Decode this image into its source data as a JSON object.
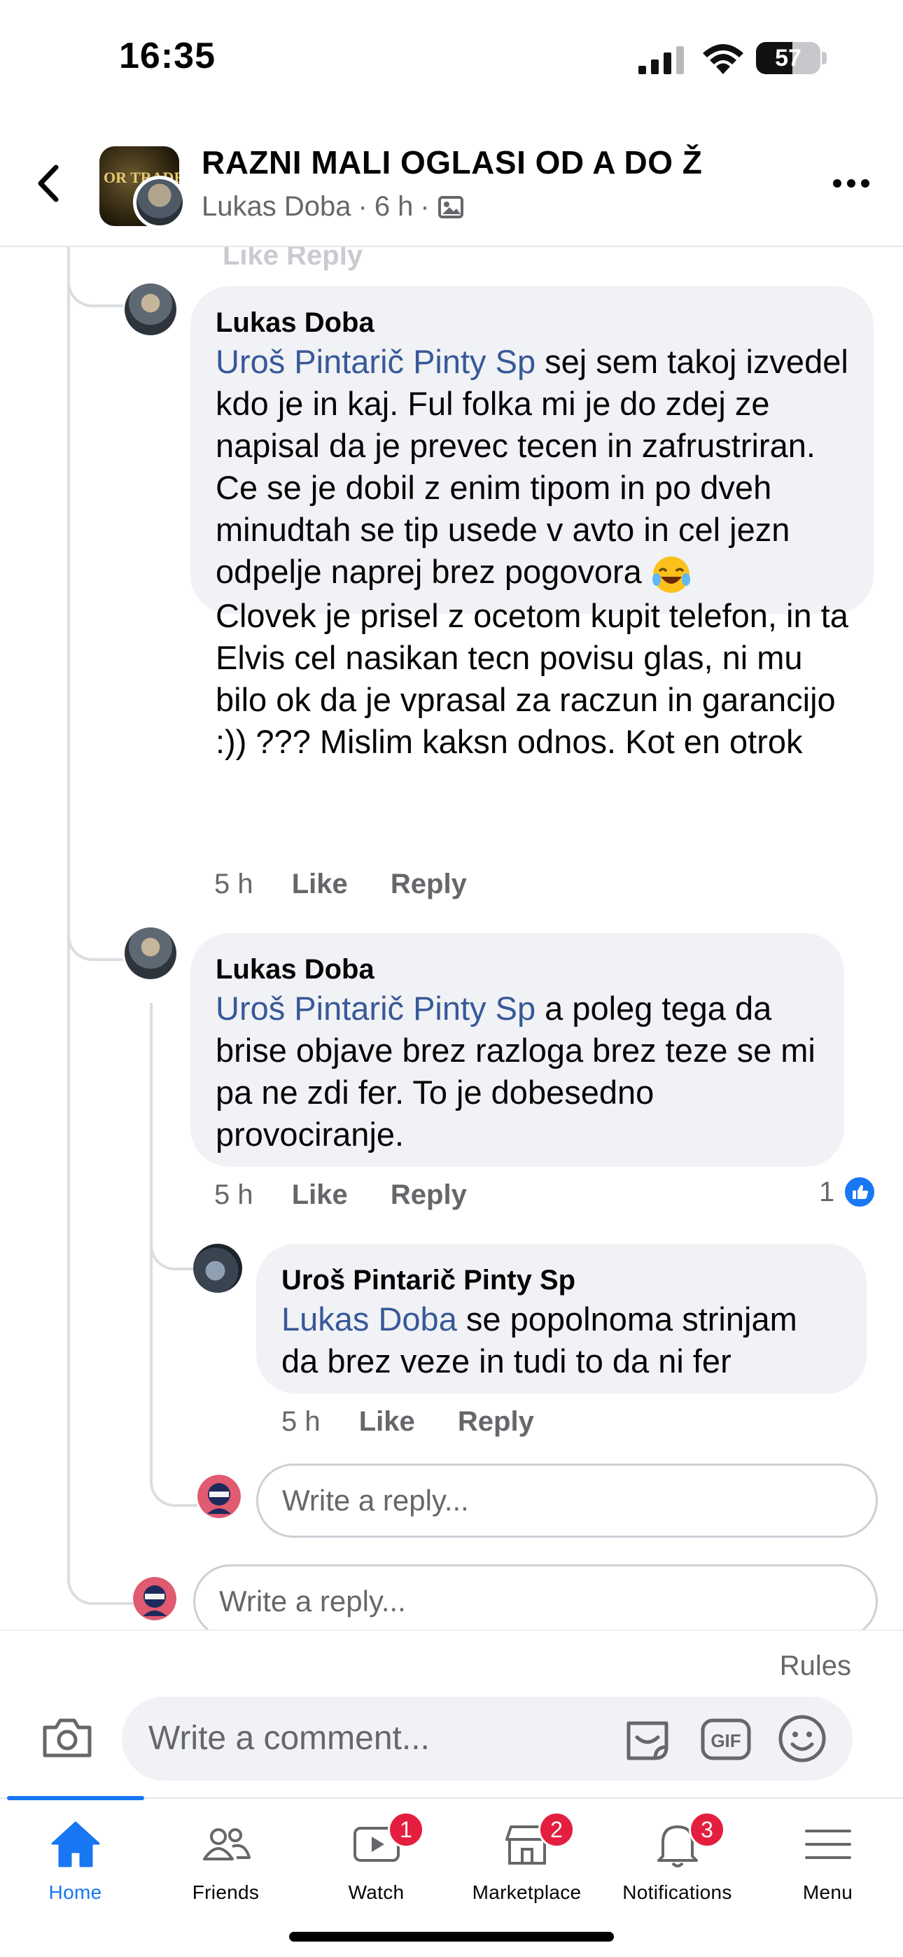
{
  "status_bar": {
    "time": "16:35",
    "battery": "57",
    "battery_level": 0.57
  },
  "header": {
    "group_name": "RAZNI MALI OGLASI OD A DO Ž",
    "thumb_text": "OR TRADE",
    "author": "Lukas Doba",
    "separator": "·",
    "age": "6 h",
    "icons": [
      "back-icon",
      "photo-privacy-icon",
      "more-icon"
    ]
  },
  "thread": {
    "faded_actions": "Like  Reply",
    "comments": [
      {
        "author": "Lukas Doba",
        "mention": "Uroš Pintarič Pinty Sp",
        "text": " sej sem takoj izvedel kdo je in kaj. Ful folka mi je do zdej ze napisal da je prevec tecen in zafrustriran. Ce se je dobil z enim tipom in po dveh minudtah se tip usede v avto in cel jezn odpelje naprej brez pogovora ",
        "emoji": "face-with-tears-of-joy",
        "text2": "Clovek je prisel z ocetom kupit telefon, in ta Elvis cel nasikan tecn povisu glas, ni mu bilo ok da je vprasal za raczun in garancijo :)) ??? Mislim kaksn odnos. Kot en otrok",
        "time": "5 h",
        "like": "Like",
        "reply": "Reply"
      },
      {
        "author": "Lukas Doba",
        "mention": "Uroš Pintarič Pinty Sp",
        "text": " a poleg tega da brise objave brez razloga brez teze se mi pa ne zdi fer. To je dobesedno provociranje.",
        "time": "5 h",
        "like": "Like",
        "reply": "Reply",
        "reaction_count": "1"
      },
      {
        "author": "Uroš Pintarič Pinty Sp",
        "mention": "Lukas Doba",
        "text": " se popolnoma strinjam da brez veze in tudi to da ni fer",
        "time": "5 h",
        "like": "Like",
        "reply": "Reply"
      }
    ],
    "reply_placeholder": "Write a reply..."
  },
  "composer": {
    "rules": "Rules",
    "placeholder": "Write a comment...",
    "icons": [
      "camera-icon",
      "sticker-icon",
      "gif-icon",
      "emoji-icon"
    ]
  },
  "tabs": [
    {
      "label": "Home",
      "icon": "home-icon",
      "active": true
    },
    {
      "label": "Friends",
      "icon": "friends-icon"
    },
    {
      "label": "Watch",
      "icon": "watch-icon",
      "badge": "1"
    },
    {
      "label": "Marketplace",
      "icon": "marketplace-icon",
      "badge": "2"
    },
    {
      "label": "Notifications",
      "icon": "bell-icon",
      "badge": "3"
    },
    {
      "label": "Menu",
      "icon": "menu-icon"
    }
  ],
  "colors": {
    "accent": "#1877f2",
    "mention": "#385898",
    "bubble": "#f0f2f5",
    "badge": "#e41e3f",
    "secondary_text": "#65676b"
  }
}
